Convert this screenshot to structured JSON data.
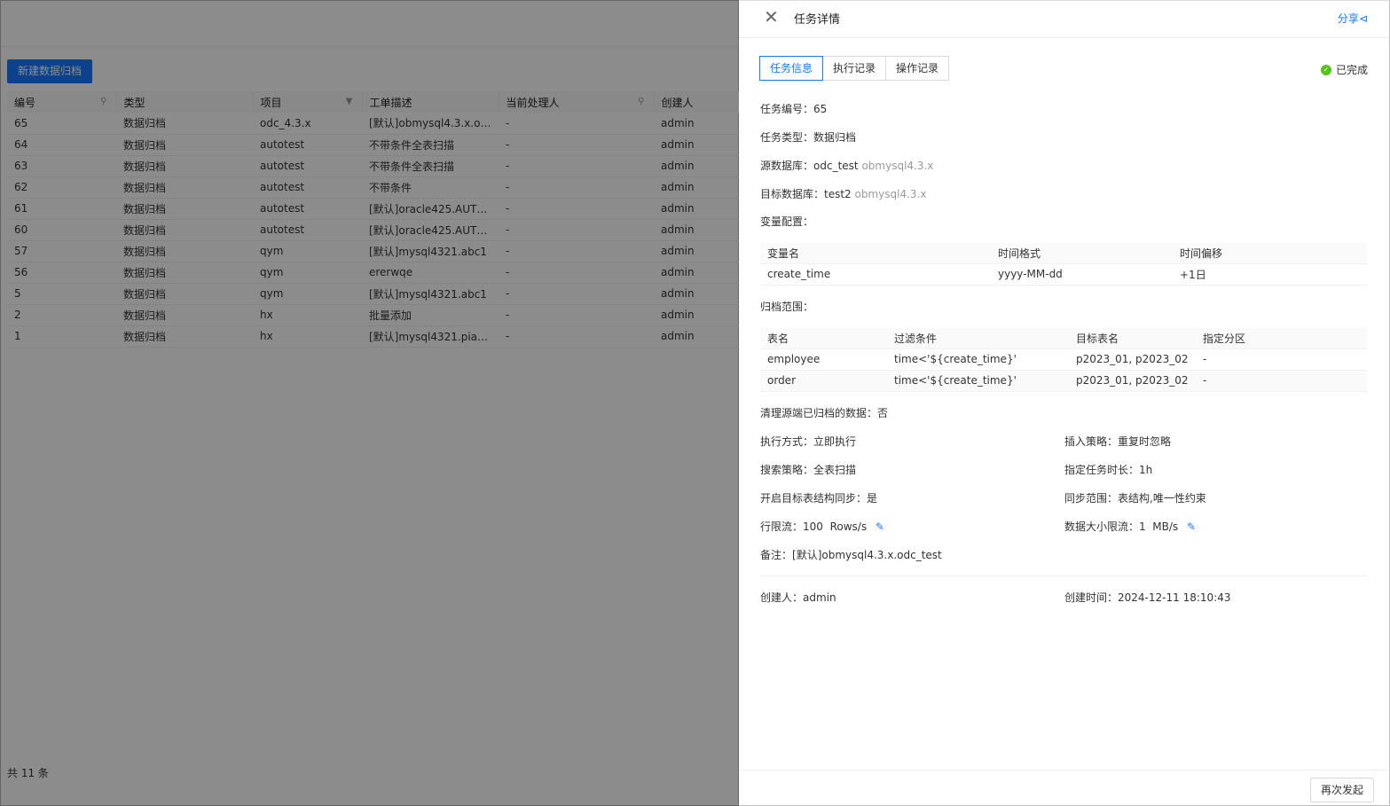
{
  "background": {
    "new_button": "新建数据归档",
    "columns": [
      "编号",
      "类型",
      "项目",
      "工单描述",
      "当前处理人",
      "创建人"
    ],
    "rows": [
      [
        "65",
        "数据归档",
        "odc_4.3.x",
        "[默认]obmysql4.3.x.odc_...",
        "-",
        "admin"
      ],
      [
        "64",
        "数据归档",
        "autotest",
        "不带条件全表扫描",
        "-",
        "admin"
      ],
      [
        "63",
        "数据归档",
        "autotest",
        "不带条件全表扫描",
        "-",
        "admin"
      ],
      [
        "62",
        "数据归档",
        "autotest",
        "不带条件",
        "-",
        "admin"
      ],
      [
        "61",
        "数据归档",
        "autotest",
        "[默认]oracle425.AUTO_...",
        "-",
        "admin"
      ],
      [
        "60",
        "数据归档",
        "autotest",
        "[默认]oracle425.AUTO_...",
        "-",
        "admin"
      ],
      [
        "57",
        "数据归档",
        "qym",
        "[默认]mysql4321.abc1",
        "-",
        "admin"
      ],
      [
        "56",
        "数据归档",
        "qym",
        "ererwqe",
        "-",
        "admin"
      ],
      [
        "5",
        "数据归档",
        "qym",
        "[默认]mysql4321.abc1",
        "-",
        "admin"
      ],
      [
        "2",
        "数据归档",
        "hx",
        "批量添加",
        "-",
        "admin"
      ],
      [
        "1",
        "数据归档",
        "hx",
        "[默认]mysql4321.piaoyue",
        "-",
        "admin"
      ]
    ],
    "total": "共 11 条"
  },
  "drawer": {
    "title": "任务详情",
    "share": "分享",
    "tabs": [
      "任务信息",
      "执行记录",
      "操作记录"
    ],
    "status": "已完成",
    "task_id_label": "任务编号：",
    "task_id": "65",
    "task_type_label": "任务类型：",
    "task_type": "数据归档",
    "source_db_label": "源数据库：",
    "source_db": "odc_test",
    "source_db_conn": "obmysql4.3.x",
    "target_db_label": "目标数据库：",
    "target_db": "test2",
    "target_db_conn": "obmysql4.3.x",
    "variables_label": "变量配置：",
    "variables_columns": [
      "变量名",
      "时间格式",
      "时间偏移"
    ],
    "variables_rows": [
      [
        "create_time",
        "yyyy-MM-dd",
        "+1日"
      ]
    ],
    "range_label": "归档范围：",
    "range_columns": [
      "表名",
      "过滤条件",
      "目标表名",
      "指定分区"
    ],
    "range_rows": [
      [
        "employee",
        "time<'${create_time}'",
        "p2023_01, p2023_02",
        "-"
      ],
      [
        "order",
        "time<'${create_time}'",
        "p2023_01, p2023_02",
        "-"
      ]
    ],
    "clean_label": "清理源端已归档的数据：",
    "clean_value": "否",
    "exec_mode_label": "执行方式：",
    "exec_mode": "立即执行",
    "insert_policy_label": "插入策略：",
    "insert_policy": "重复时忽略",
    "search_policy_label": "搜索策略：",
    "search_policy": "全表扫描",
    "duration_label": "指定任务时长：",
    "duration": "1h",
    "sync_label": "开启目标表结构同步：",
    "sync_value": "是",
    "sync_range_label": "同步范围：",
    "sync_range": "表结构,唯一性约束",
    "row_limit_label": "行限流：",
    "row_limit": "100",
    "row_limit_unit": "Rows/s",
    "size_limit_label": "数据大小限流：",
    "size_limit": "1",
    "size_limit_unit": "MB/s",
    "remark_label": "备注：",
    "remark": "[默认]obmysql4.3.x.odc_test",
    "creator_label": "创建人：",
    "creator": "admin",
    "created_time_label": "创建时间：",
    "created_time": "2024-12-11 18:10:43",
    "relaunch": "再次发起"
  },
  "icons": {
    "close": "close-icon",
    "share": "share-icon",
    "status": "check-circle-icon",
    "edit": "edit-icon",
    "search": "search-icon",
    "filter": "filter-icon"
  },
  "colors": {
    "primary": "#1677ff",
    "success": "#52c41a"
  }
}
